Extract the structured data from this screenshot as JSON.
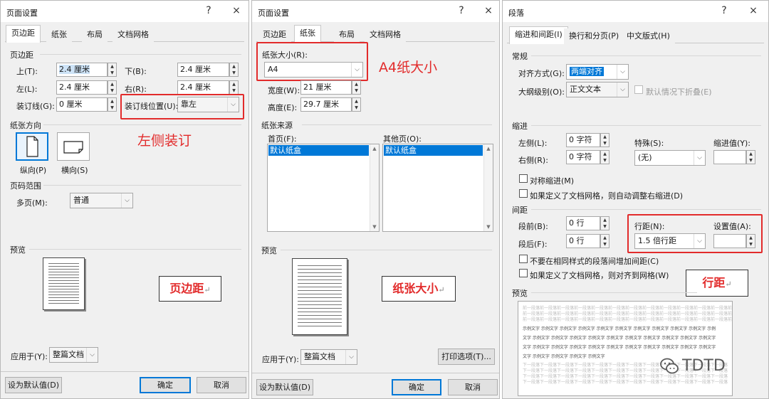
{
  "dialog1": {
    "title": "页面设置",
    "help": "?",
    "close": "×",
    "tabs": [
      "页边距",
      "纸张",
      "布局",
      "文档网格"
    ],
    "margins_group": "页边距",
    "top_label": "上(T):",
    "top_value": "2.4 厘米",
    "bottom_label": "下(B):",
    "bottom_value": "2.4 厘米",
    "left_label": "左(L):",
    "left_value": "2.4 厘米",
    "right_label": "右(R):",
    "right_value": "2.4 厘米",
    "gutter_label": "装订线(G):",
    "gutter_value": "0 厘米",
    "gutter_pos_label": "装订线位置(U):",
    "gutter_pos_value": "靠左",
    "orientation_group": "纸张方向",
    "portrait": "纵向(P)",
    "landscape": "横向(S)",
    "pages_group": "页码范围",
    "multi_label": "多页(M):",
    "multi_value": "普通",
    "preview_group": "预览",
    "apply_label": "应用于(Y):",
    "apply_value": "整篇文档",
    "default_btn": "设为默认值(D)",
    "ok_btn": "确定",
    "cancel_btn": "取消"
  },
  "dialog2": {
    "title": "页面设置",
    "help": "?",
    "close": "×",
    "tabs": [
      "页边距",
      "纸张",
      "布局",
      "文档网格"
    ],
    "size_label": "纸张大小(R):",
    "size_value": "A4",
    "width_label": "宽度(W):",
    "width_value": "21 厘米",
    "height_label": "高度(E):",
    "height_value": "29.7 厘米",
    "source_group": "纸张来源",
    "first_label": "首页(F):",
    "first_item": "默认纸盒",
    "other_label": "其他页(O):",
    "other_item": "默认纸盒",
    "preview_group": "预览",
    "apply_label": "应用于(Y):",
    "apply_value": "整篇文档",
    "print_btn": "打印选项(T)...",
    "default_btn": "设为默认值(D)",
    "ok_btn": "确定",
    "cancel_btn": "取消"
  },
  "dialog3": {
    "title": "段落",
    "help": "?",
    "close": "×",
    "tabs": [
      "缩进和间距(I)",
      "换行和分页(P)",
      "中文版式(H)"
    ],
    "general_group": "常规",
    "align_label": "对齐方式(G):",
    "align_value": "两端对齐",
    "outline_label": "大纲级别(O):",
    "outline_value": "正文文本",
    "collapse_label": "默认情况下折叠(E)",
    "indent_group": "缩进",
    "left_label": "左侧(L):",
    "left_value": "0 字符",
    "right_label": "右侧(R):",
    "right_value": "0 字符",
    "special_label": "特殊(S):",
    "special_value": "(无)",
    "indent_by_label": "缩进值(Y):",
    "mirror_label": "对称缩进(M)",
    "grid_indent_label": "如果定义了文档网格，则自动调整右缩进(D)",
    "spacing_group": "间距",
    "before_label": "段前(B):",
    "before_value": "0 行",
    "after_label": "段后(F):",
    "after_value": "0 行",
    "line_label": "行距(N):",
    "line_value": "1.5 倍行距",
    "at_label": "设置值(A):",
    "no_space_label": "不要在相同样式的段落间增加间距(C)",
    "snap_label": "如果定义了文档网格，则对齐到网格(W)",
    "preview_group": "预览",
    "preview_prev": "前一段落前一段落前一段落前一段落前一段落前一段落前一段落前一段落前一段落前一段落前一段落前一段落前一段落",
    "preview_sample_1": "示例文字 示例文字 示例文字 示例文字 示例文字 示例文字 示例文字 示例文字 示例文字 示例文字 示例",
    "preview_sample_2": "文字 示例文字 示例文字 示例文字 示例文字 示例文字 示例文字 示例文字 示例文字 示例文字 示例文字",
    "preview_sample_3": "文字 示例文字 示例文字 示例文字 示例文字",
    "preview_next": "下一段落下一段落下一段落下一段落下一段落下一段落下一段落下一段落下一段落下一段落下一段落下一段落"
  },
  "annotations": {
    "left_binding": "左侧装订",
    "a4_size": "A4纸大小",
    "margin_box": "页边距",
    "paper_box": "纸张大小",
    "line_box": "行距",
    "return_mark": "↵"
  },
  "watermark": "TDTD",
  "colors": {
    "accent": "#0078d7",
    "annotation": "#e22b2b",
    "dialog_bg": "#f0f0f0"
  }
}
